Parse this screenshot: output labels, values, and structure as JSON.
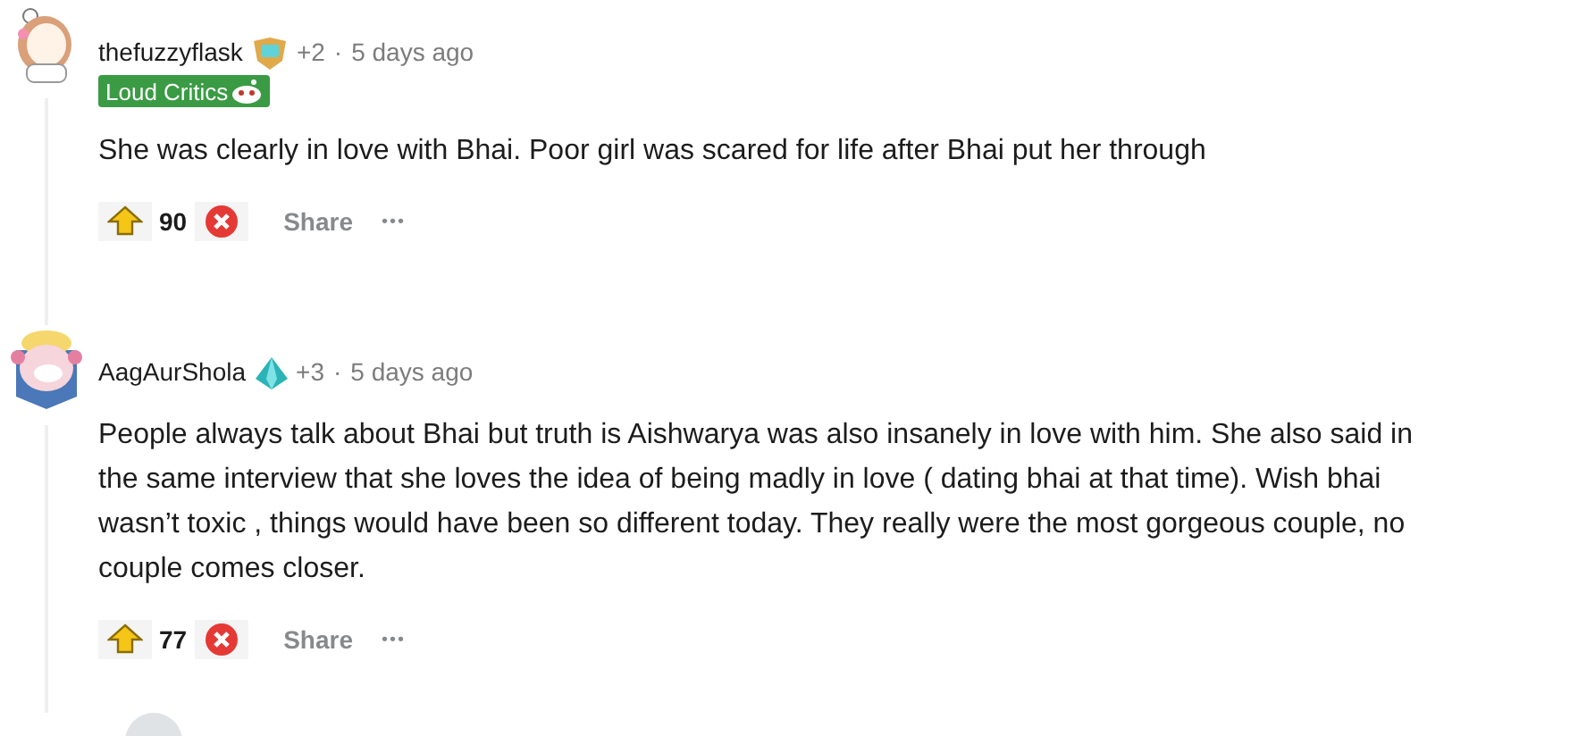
{
  "comments": [
    {
      "username": "thefuzzyflask",
      "award_count": "+2",
      "separator": "·",
      "time": "5 days ago",
      "flair": "Loud Critics",
      "body": "She was clearly in love with Bhai. Poor girl was scared for life after Bhai put her through",
      "votes": "90",
      "share": "Share",
      "more": "•••",
      "avatar": {
        "kind": "girl"
      },
      "badge": {
        "kind": "shield"
      }
    },
    {
      "username": "AagAurShola",
      "award_count": "+3",
      "separator": "·",
      "time": "5 days ago",
      "body": "People always talk about Bhai but truth is Aishwarya was also insanely in love with him. She also said in the same interview that she loves the idea of being madly in love ( dating bhai at that time). Wish bhai wasn’t toxic , things would have been so different today. They really were the most gorgeous couple, no couple comes closer.",
      "votes": "77",
      "share": "Share",
      "more": "•••",
      "avatar": {
        "kind": "axolotl"
      },
      "badge": {
        "kind": "gem"
      }
    }
  ]
}
